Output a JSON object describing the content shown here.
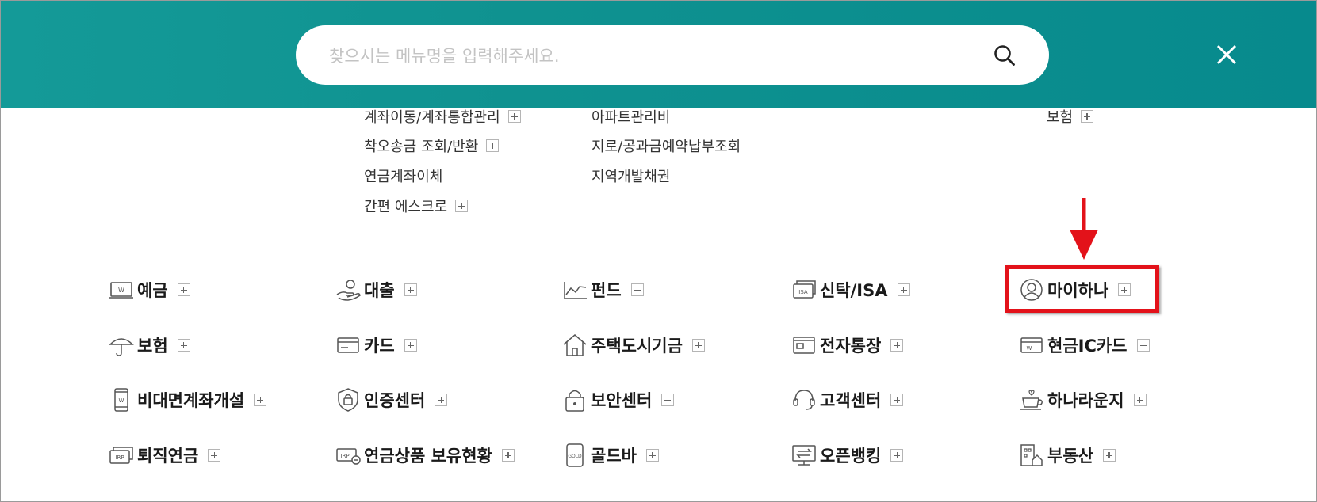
{
  "search": {
    "placeholder": "찾으시는 메뉴명을 입력해주세요.",
    "value": ""
  },
  "icons": {
    "search": "search-icon",
    "close": "close-icon",
    "expand": "plus-icon"
  },
  "colors": {
    "header": "#0f9290",
    "highlight": "#e3121a"
  },
  "submenu": {
    "col1": [
      "계좌이동/계좌통합관리",
      "착오송금 조회/반환",
      "연금계좌이체",
      "간편 에스크로"
    ],
    "col2": [
      "아파트관리비",
      "지로/공과금예약납부조회",
      "지역개발채권"
    ],
    "col3": [
      "보험"
    ]
  },
  "menu": {
    "row1": [
      "예금",
      "대출",
      "펀드",
      "신탁/ISA",
      "마이하나"
    ],
    "row2": [
      "보험",
      "카드",
      "주택도시기금",
      "전자통장",
      "현금IC카드"
    ],
    "row3": [
      "비대면계좌개설",
      "인증센터",
      "보안센터",
      "고객센터",
      "하나라운지"
    ],
    "row4": [
      "퇴직연금",
      "연금상품 보유현황",
      "골드바",
      "오픈뱅킹",
      "부동산"
    ]
  }
}
